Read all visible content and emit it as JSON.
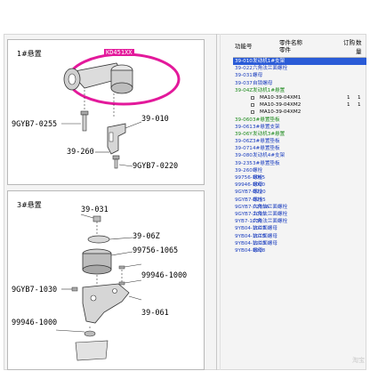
{
  "diagram_top": {
    "title": "1#悬置",
    "part_tag": "KD451XX",
    "callouts": [
      "9GYB7-0255",
      "39-010",
      "39-260",
      "9GYB7-0220"
    ]
  },
  "diagram_bottom": {
    "title": "3#悬置",
    "callouts": [
      "39-031",
      "39-06Z",
      "99756-1065",
      "99946-1000",
      "9GYB7-1030",
      "99946-1000",
      "39-061"
    ]
  },
  "table": {
    "headers": {
      "code": "功能号",
      "name": "零件名称",
      "name2": "零件",
      "qty": "订购",
      "qty2": "数量"
    },
    "rows": [
      {
        "code": "39-010",
        "name": "发动机1#支架",
        "style": "sel"
      },
      {
        "code": "39-022",
        "name": "六角法兰面螺栓",
        "style": "blue"
      },
      {
        "code": "39-031",
        "name": "螺母",
        "style": "blue"
      },
      {
        "code": "39-037",
        "name": "自锁螺母",
        "style": "blue"
      },
      {
        "code": "39-04Z",
        "name": "发动机1#悬置",
        "style": "green"
      },
      {
        "code": "",
        "name": "MA10-39-04XM1",
        "qty": "1",
        "qty2": "1",
        "style": "black",
        "check": true
      },
      {
        "code": "",
        "name": "MA10-39-04XM2",
        "qty": "1",
        "qty2": "1",
        "style": "black",
        "check": true
      },
      {
        "code": "",
        "name": "MA10-39-04XM2",
        "style": "black",
        "check": true
      },
      {
        "code": "39-060",
        "name": "3#悬置垫板",
        "style": "green"
      },
      {
        "code": "39-061",
        "name": "3#悬置支架",
        "style": "blue"
      },
      {
        "code": "39-06Y",
        "name": "发动机3#悬置",
        "style": "green"
      },
      {
        "code": "39-06Z",
        "name": "3#悬置垫板",
        "style": "blue"
      },
      {
        "code": "39-071",
        "name": "4#悬置垫板",
        "style": "blue"
      },
      {
        "code": "39-080",
        "name": "发动机4#支架",
        "style": "blue"
      },
      {
        "code": "39-235",
        "name": "3#悬置垫板",
        "style": "blue"
      },
      {
        "code": "39-260",
        "name": "螺栓",
        "style": "blue"
      },
      {
        "code": "99756-1065",
        "name": "螺栓",
        "style": "blue"
      },
      {
        "code": "99946-1000",
        "name": "螺母",
        "style": "blue"
      },
      {
        "code": "9GYB7-0220",
        "name": "螺栓",
        "style": "blue"
      },
      {
        "code": "9GYB7-0255",
        "name": "螺栓",
        "style": "blue"
      },
      {
        "code": "9GYB7-0255A",
        "name": "六角法兰面螺栓",
        "style": "blue"
      },
      {
        "code": "9GYB7-1025",
        "name": "六角法兰面螺栓",
        "style": "blue"
      },
      {
        "code": "9YB7-1030",
        "name": "六角法兰面螺栓",
        "style": "blue"
      },
      {
        "code": "9YB04-1007",
        "name": "法兰面螺母",
        "style": "blue"
      },
      {
        "code": "9YB04-1015",
        "name": "法兰面螺母",
        "style": "blue"
      },
      {
        "code": "9YB04-1203",
        "name": "法兰面螺母",
        "style": "blue"
      },
      {
        "code": "9YB04-1208",
        "name": "螺母",
        "style": "blue"
      }
    ]
  },
  "watermark": "淘宝"
}
